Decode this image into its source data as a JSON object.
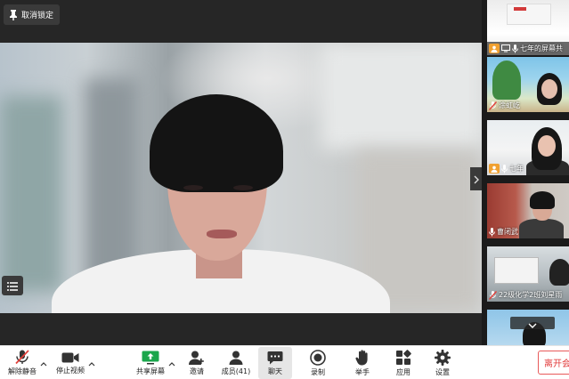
{
  "stage": {
    "unpin_label": "取消锁定"
  },
  "participants": [
    {
      "name": "七年的屏幕共",
      "host": true,
      "mic": "on"
    },
    {
      "name": "涂虹屹",
      "host": false,
      "mic": "muted"
    },
    {
      "name": "七年",
      "host": true,
      "mic": "on"
    },
    {
      "name": "曹闭武",
      "host": false,
      "mic": "on"
    },
    {
      "name": "22级化学2班刘星雨",
      "host": false,
      "mic": "muted"
    }
  ],
  "toolbar": {
    "unmute_label": "解除静音",
    "stop_video_label": "停止视频",
    "share_screen_label": "共享屏幕",
    "invite_label": "邀请",
    "members_label": "成员(41)",
    "chat_label": "聊天",
    "record_label": "录制",
    "raise_hand_label": "举手",
    "apps_label": "应用",
    "settings_label": "设置",
    "leave_label": "离开会议"
  },
  "colors": {
    "accent_green": "#1aa64b",
    "leave_red": "#e23b3b",
    "muted_red": "#e0403a",
    "host_orange": "#f0a030"
  }
}
